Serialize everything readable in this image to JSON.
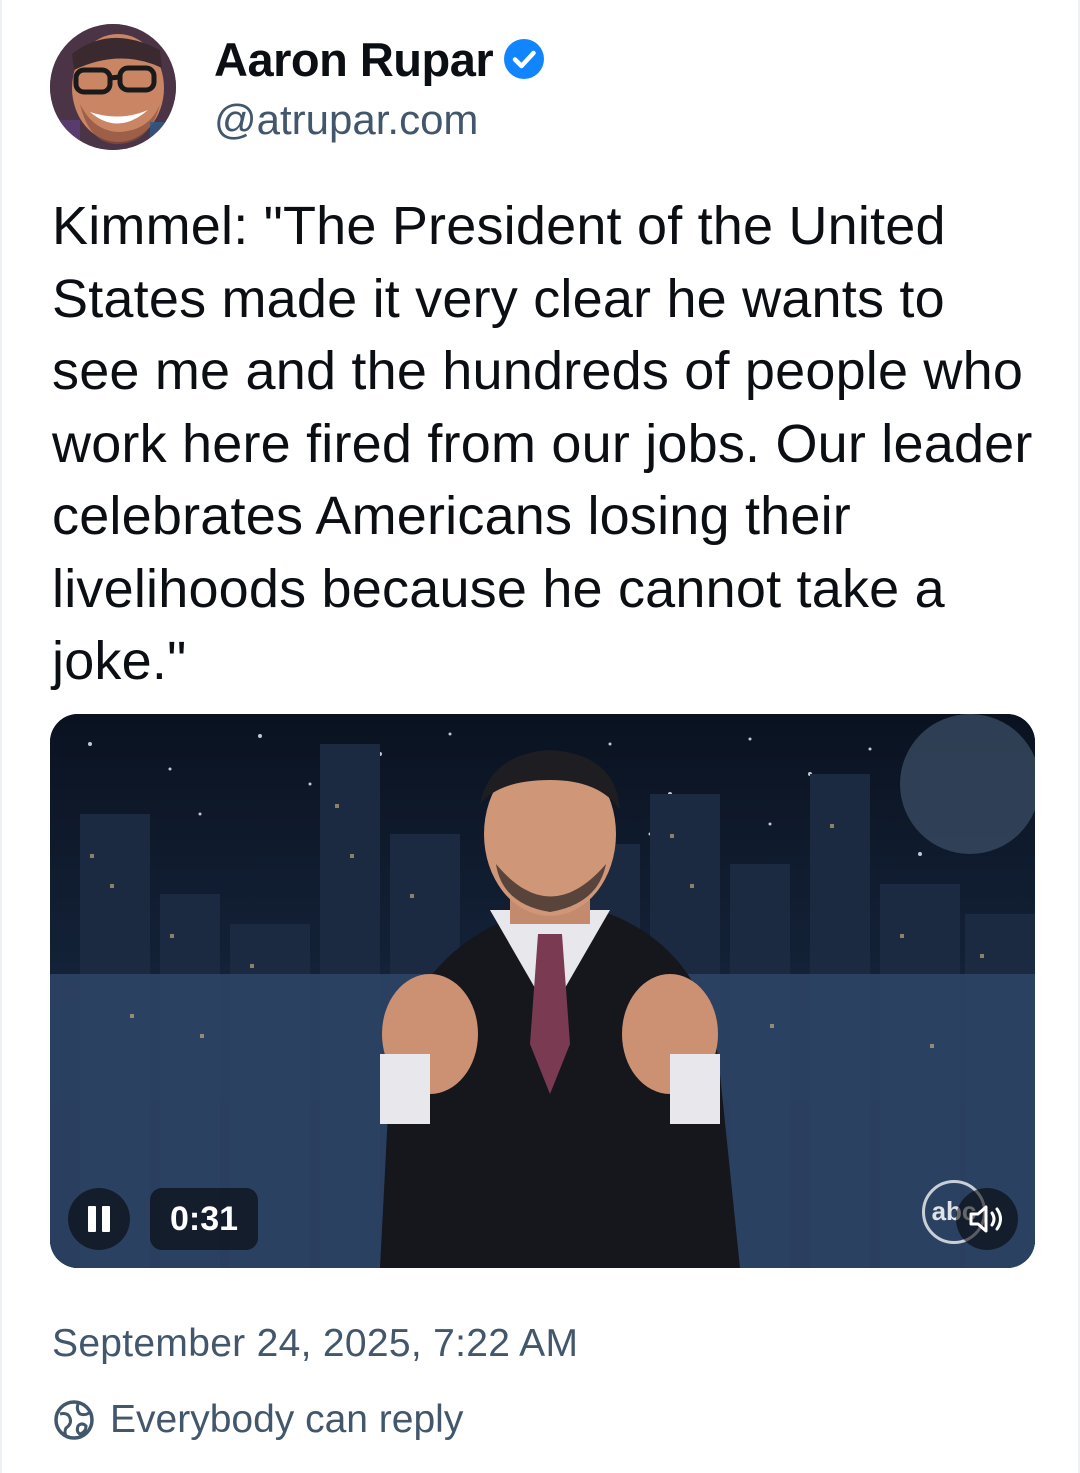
{
  "author": {
    "display_name": "Aaron Rupar",
    "handle": "@atrupar.com",
    "verified_icon": "verified-check-icon",
    "avatar_icon": "avatar-photo"
  },
  "post": {
    "text": "Kimmel: \"The President of the United States made it very clear he wants to see me and the hundreds of people who work here fired from our jobs. Our leader celebrates Americans losing their livelihoods because he cannot take a joke.\""
  },
  "video": {
    "elapsed_time": "0:31",
    "playback_state": "playing",
    "pause_icon": "pause-icon",
    "mute_icon": "speaker-icon",
    "watermark": "abc"
  },
  "meta": {
    "timestamp": "September 24, 2025, 7:22 AM",
    "reply_setting": "Everybody can reply",
    "reply_icon": "globe-icon"
  },
  "colors": {
    "accent": "#1185fe",
    "secondary_text": "#42576c",
    "primary_text": "#0b0f14"
  }
}
